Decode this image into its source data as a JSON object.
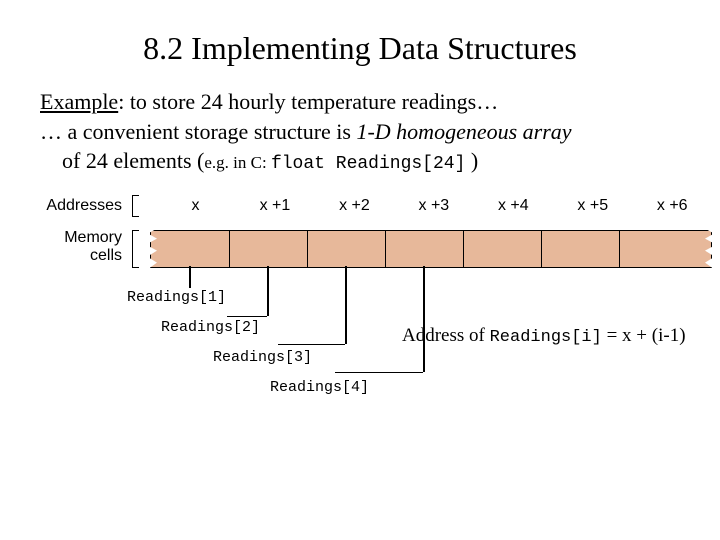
{
  "title": "8.2  Implementing Data Structures",
  "example_lead": "Example",
  "example_rest": ": to store 24 hourly temperature readings…",
  "line2_prefix": "…  a convenient storage structure is ",
  "array_term": "1-D homogeneous array",
  "line2_mid": " of 24 elements (",
  "eg_text": "e.g. in C:  ",
  "code_decl": "float Readings[24]",
  "line2_tail": " )",
  "labels": {
    "addresses": "Addresses",
    "memory": "Memory",
    "cells": "cells"
  },
  "addresses": [
    "x",
    "x +1",
    "x +2",
    "x +3",
    "x +4",
    "x +5",
    "x +6"
  ],
  "readings": [
    "Readings[1]",
    "Readings[2]",
    "Readings[3]",
    "Readings[4]"
  ],
  "formula": {
    "pre": "Address of ",
    "code": "Readings[i]",
    "post": " =   x + (i-1)"
  }
}
